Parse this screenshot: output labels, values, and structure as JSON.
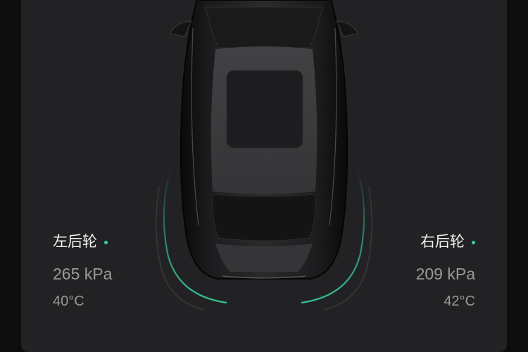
{
  "colors": {
    "background": "#0d0d0e",
    "panel": "#222224",
    "accent": "#36d7a3",
    "primary_text": "#f2f2f2",
    "secondary_text": "#9a9a9a"
  },
  "tires": {
    "rear_left": {
      "label": "左后轮",
      "pressure": "265 kPa",
      "temperature": "40°C",
      "status_icon": "status-dot"
    },
    "rear_right": {
      "label": "右后轮",
      "pressure": "209 kPa",
      "temperature": "42°C",
      "status_icon": "status-dot"
    }
  }
}
